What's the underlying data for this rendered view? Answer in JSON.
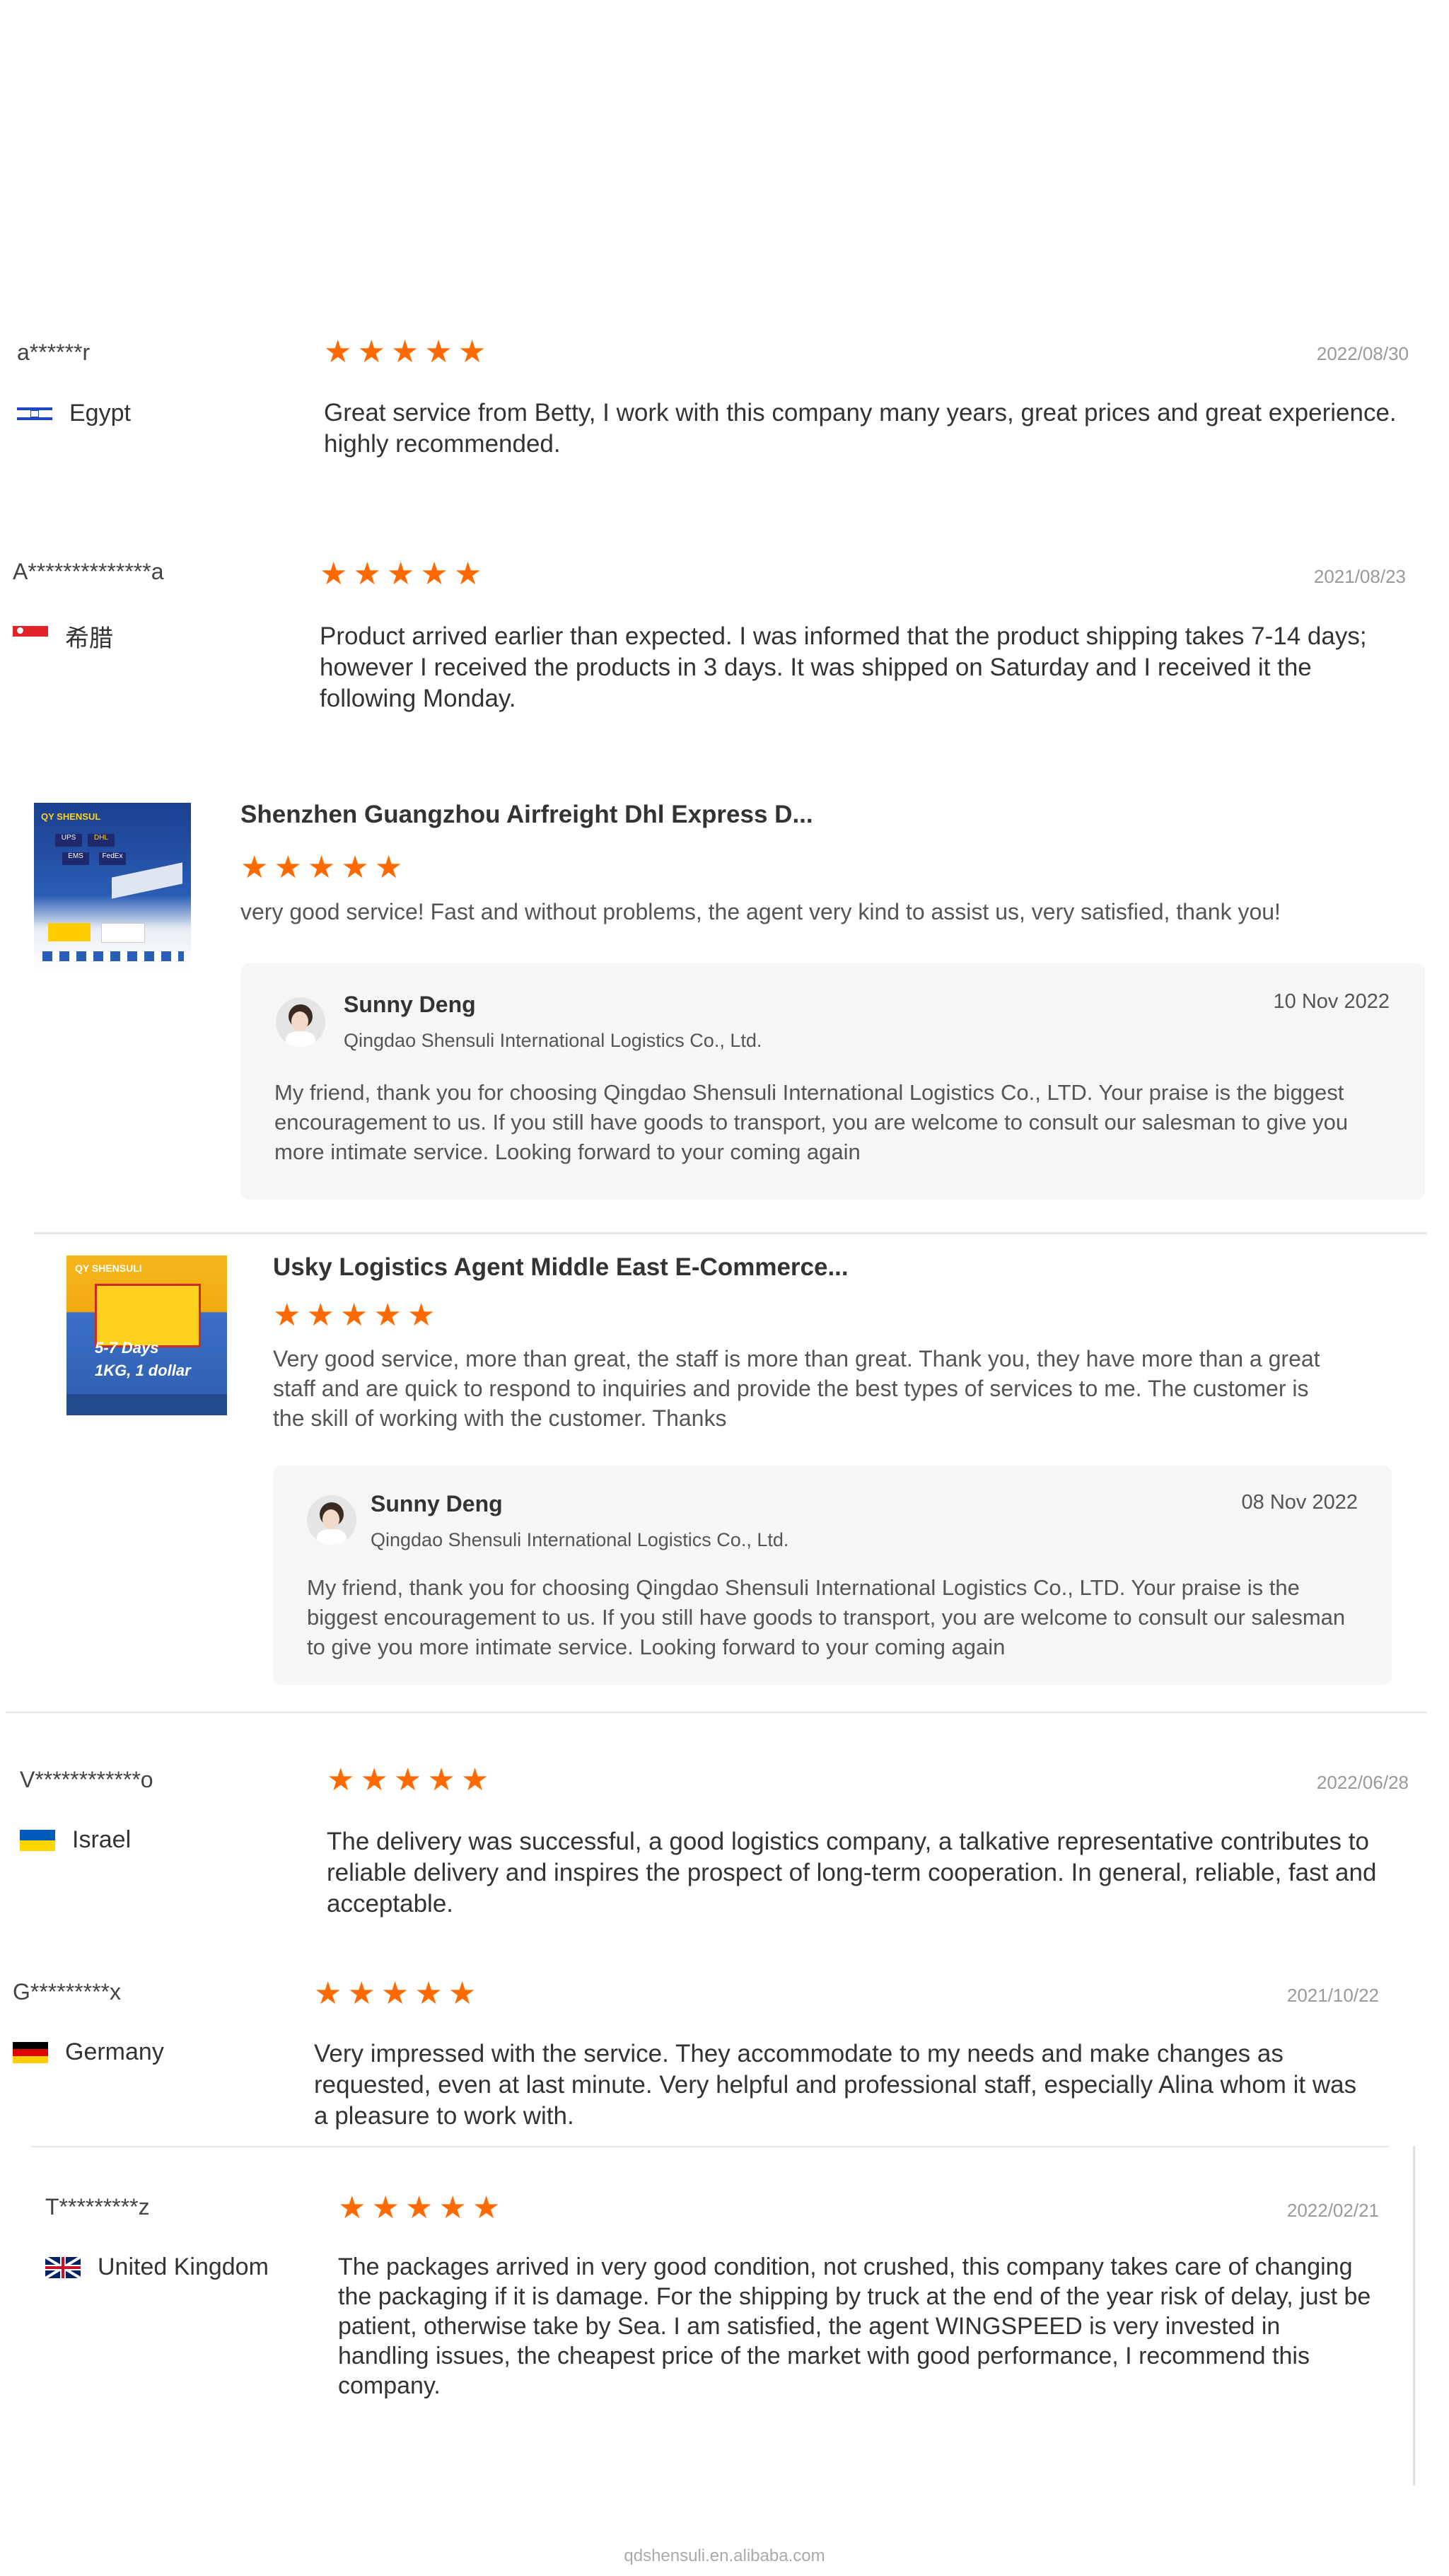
{
  "reviews": [
    {
      "buyer": "a******r",
      "country": "Egypt",
      "date": "2022/08/30",
      "text": "Great service from Betty, I work with this company many years, great prices and great experience. highly recommended."
    },
    {
      "buyer": "A**************a",
      "country": "希腊",
      "date": "2021/08/23",
      "text": "Product arrived earlier than expected. I was informed that the product shipping takes 7-14 days; however I received the products in 3 days. It was shipped on Saturday and I received it the following Monday."
    },
    {
      "buyer": "V************o",
      "country": "Israel",
      "date": "2022/06/28",
      "text": "The delivery was successful, a good logistics company, a talkative representative contributes to reliable delivery and inspires the prospect of long-term cooperation. In general, reliable, fast and acceptable."
    },
    {
      "buyer": "G*********x",
      "country": "Germany",
      "date": "2021/10/22",
      "text": "Very impressed with the service. They accommodate to my needs and make changes as requested, even at last minute. Very helpful and professional staff, especially Alina whom it was a pleasure to work with."
    },
    {
      "buyer": "T*********z",
      "country": "United Kingdom",
      "date": "2022/02/21",
      "text": "The packages arrived in very good condition, not crushed, this company takes care of changing the packaging if it is damage. For the shipping by truck at the end of the year risk of delay, just be patient, otherwise take by Sea. I am satisfied, the agent WINGSPEED is very invested in handling issues, the cheapest price of the market with good performance, I recommend this company."
    }
  ],
  "product_reviews": [
    {
      "title": "Shenzhen Guangzhou Airfreight Dhl Express D...",
      "text": "very good service! Fast and without problems, the agent very kind to assist us, very satisfied, thank you!",
      "thumb_labels": [
        "QY SHENSUL",
        "UPS",
        "DHL",
        "EMS",
        "FedEx"
      ],
      "reply": {
        "name": "Sunny Deng",
        "company": "Qingdao Shensuli International Logistics Co., Ltd.",
        "date": "10 Nov 2022",
        "text": "My friend, thank you for choosing Qingdao Shensuli International Logistics Co., LTD. Your praise is the biggest encouragement to us. If you still have goods to transport, you are welcome to consult our salesman to give you more intimate service. Looking forward to your coming again"
      }
    },
    {
      "title": "Usky Logistics Agent Middle East E-Commerce...",
      "text": "Very good service, more than great, the staff is more than great.  Thank you, they have more than a great staff and are quick to respond to inquiries and provide the best types of services to me.  The customer is the skill of working with the customer.  Thanks",
      "thumb_labels": [
        "QY SHENSULI",
        "5-7 Days",
        "1KG, 1 dollar"
      ],
      "reply": {
        "name": "Sunny Deng",
        "company": "Qingdao Shensuli International Logistics Co., Ltd.",
        "date": "08 Nov 2022",
        "text": "My friend, thank you for choosing Qingdao Shensuli International Logistics Co., LTD. Your praise is the biggest encouragement to us. If you still have goods to transport, you are welcome to consult our salesman to give you more intimate service. Looking forward to your coming again"
      }
    }
  ],
  "rating": {
    "stars": 5,
    "max": 5
  },
  "colors": {
    "star": "#ff6a00",
    "reply_bg": "#f5f6f8"
  },
  "footer": "qdshensuli.en.alibaba.com"
}
